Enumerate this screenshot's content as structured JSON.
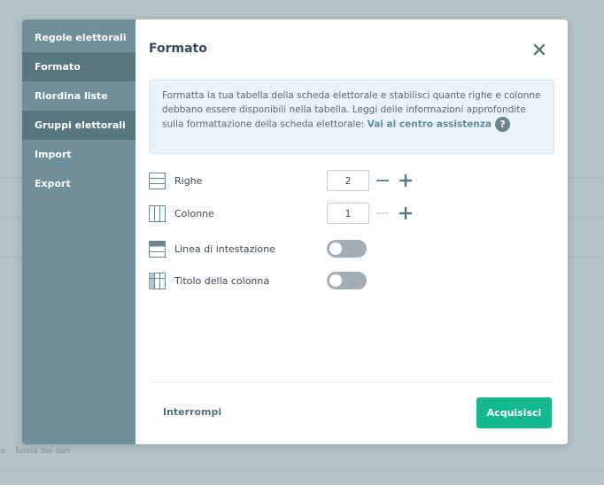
{
  "sidebar": {
    "items": [
      {
        "label": "Regole elettorali"
      },
      {
        "label": "Formato"
      },
      {
        "label": "Riordina liste"
      },
      {
        "label": "Gruppi elettorali"
      },
      {
        "label": "Import"
      },
      {
        "label": "Export"
      }
    ]
  },
  "dialog": {
    "title": "Formato",
    "info_text": "Formatta la tua tabella della scheda elettorale e stabilisci quante righe e colonne debbano essere disponibili nella tabella. Leggi delle informazioni approfondite sulla formattazione della scheda elettorale: ",
    "info_link": "Vai al centro assistenza",
    "help_icon": "?",
    "rows": {
      "label": "Righe",
      "value": "2"
    },
    "columns": {
      "label": "Colonne",
      "value": "1"
    },
    "header_line": {
      "label": "Linea di intestazione",
      "enabled": false
    },
    "column_title": {
      "label": "Titolo della colonna",
      "enabled": false
    },
    "cancel_label": "Interrompi",
    "submit_label": "Acquisisci"
  },
  "background": {
    "footer_link": "Tutela dei dati",
    "footer_fragment": "o"
  },
  "colors": {
    "sidebar": "#6f909a",
    "sidebar_active": "#58767f",
    "primary": "#16b890",
    "info_bg": "#e9f2f8",
    "toggle_off": "#a3adb6"
  }
}
